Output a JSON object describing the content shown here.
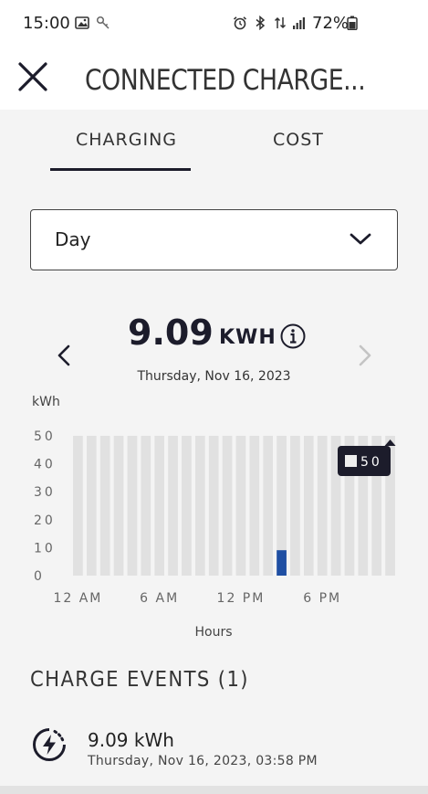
{
  "status_bar": {
    "time": "15:00",
    "battery": "72%",
    "icons": [
      "gallery-icon",
      "key-icon",
      "alarm-icon",
      "bluetooth-icon",
      "data-icon",
      "signal-icon",
      "battery-icon"
    ]
  },
  "header": {
    "title": "CONNECTED CHARGE..."
  },
  "tabs": [
    {
      "label": "CHARGING",
      "active": true
    },
    {
      "label": "COST",
      "active": false
    }
  ],
  "period_select": {
    "value": "Day"
  },
  "summary": {
    "value": "9.09",
    "unit": "KWH",
    "date": "Thursday, Nov 16, 2023"
  },
  "chart_data": {
    "type": "bar",
    "ylabel": "kWh",
    "xlabel": "Hours",
    "ylim": [
      0,
      50
    ],
    "yticks": [
      "50",
      "40",
      "30",
      "20",
      "10",
      "0"
    ],
    "xtick_labels": [
      "12 AM",
      "6 AM",
      "12 PM",
      "6 PM"
    ],
    "categories": [
      "0",
      "1",
      "2",
      "3",
      "4",
      "5",
      "6",
      "7",
      "8",
      "9",
      "10",
      "11",
      "12",
      "13",
      "14",
      "15",
      "16",
      "17",
      "18",
      "19",
      "20",
      "21",
      "22",
      "23"
    ],
    "values": [
      0,
      0,
      0,
      0,
      0,
      0,
      0,
      0,
      0,
      0,
      0,
      0,
      0,
      0,
      0,
      9.09,
      0,
      0,
      0,
      0,
      0,
      0,
      0,
      0
    ],
    "background_max": 50,
    "tooltip": "50",
    "colors": {
      "bar": "#1f4fa3",
      "track": "#e1e1e1"
    }
  },
  "events": {
    "title": "CHARGE EVENTS (1)",
    "items": [
      {
        "energy": "9.09 kWh",
        "date": "Thursday, Nov 16, 2023, 03:58 PM"
      }
    ]
  }
}
